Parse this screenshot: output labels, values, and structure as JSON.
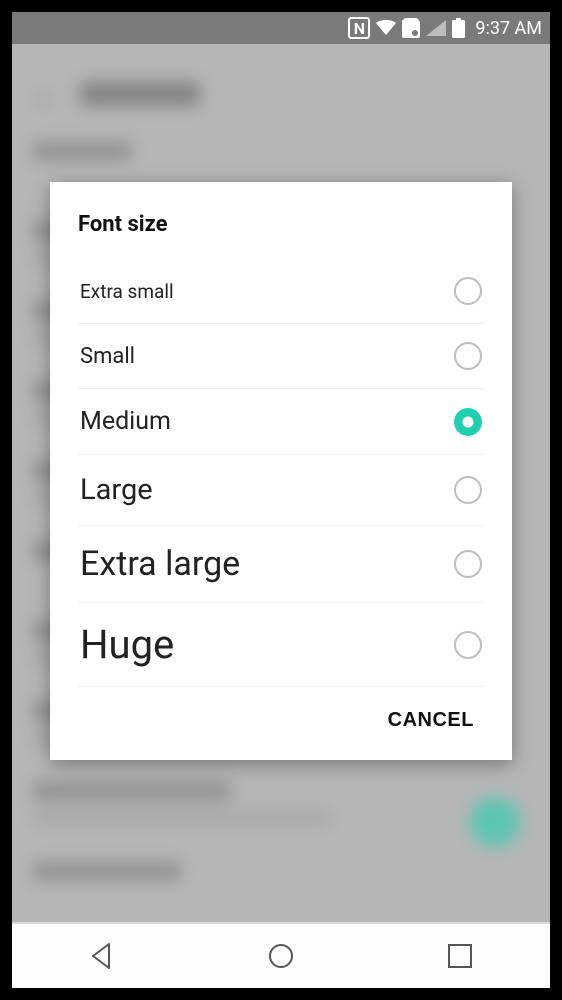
{
  "status": {
    "nfc_label": "N",
    "time": "9:37 AM"
  },
  "dialog": {
    "title": "Font size",
    "options": [
      {
        "label": "Extra small",
        "selected": false
      },
      {
        "label": "Small",
        "selected": false
      },
      {
        "label": "Medium",
        "selected": true
      },
      {
        "label": "Large",
        "selected": false
      },
      {
        "label": "Extra large",
        "selected": false
      },
      {
        "label": "Huge",
        "selected": false
      }
    ],
    "cancel_label": "CANCEL"
  },
  "colors": {
    "accent": "#20cfb0"
  }
}
